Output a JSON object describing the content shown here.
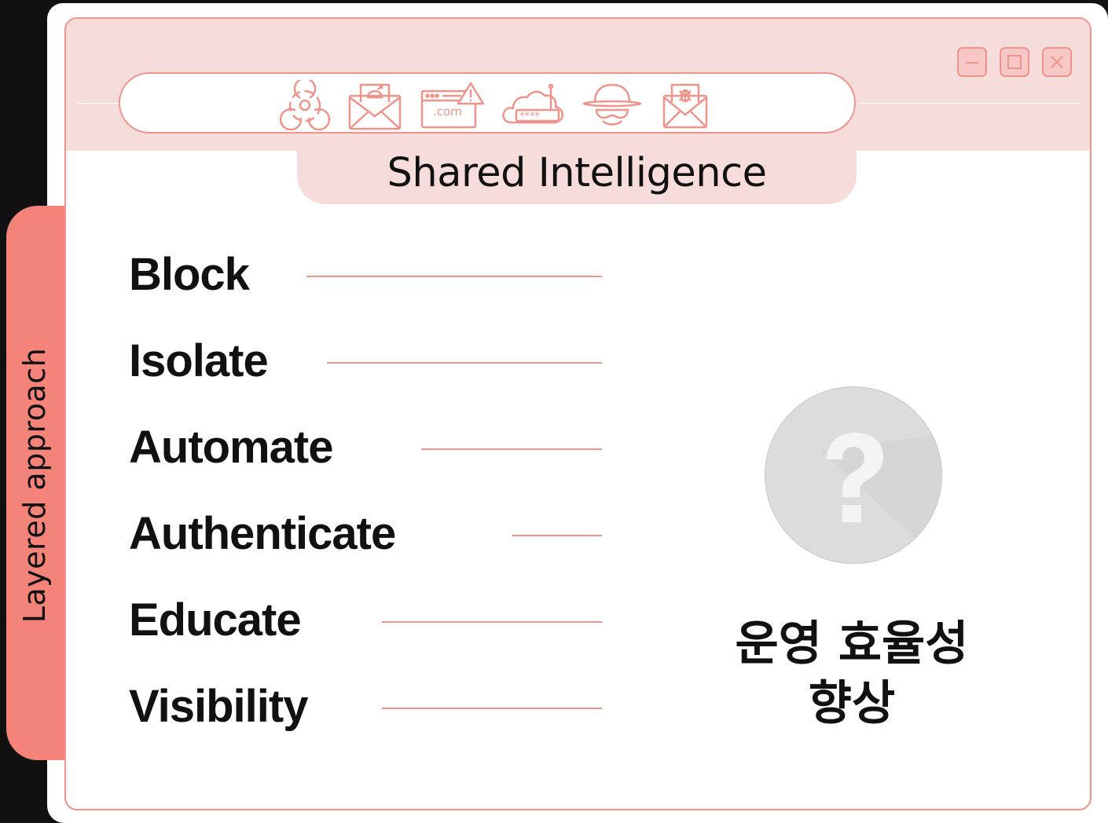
{
  "sidebar": {
    "label": "Layered approach"
  },
  "toolbar": {
    "icons": [
      "biohazard-icon",
      "phishing-mail-icon",
      "malicious-domain-icon",
      "credential-cloud-icon",
      "hacker-icon",
      "malware-mail-icon"
    ]
  },
  "window_controls": [
    "minimize-icon",
    "maximize-icon",
    "close-icon"
  ],
  "heading": {
    "title": "Shared Intelligence"
  },
  "layers": [
    {
      "label": "Block"
    },
    {
      "label": "Isolate"
    },
    {
      "label": "Automate"
    },
    {
      "label": "Authenticate"
    },
    {
      "label": "Educate"
    },
    {
      "label": "Visibility"
    }
  ],
  "result": {
    "icon": "question-mark-icon",
    "line1": "운영 효율성",
    "line2": "향상"
  },
  "colors": {
    "accent": "#f0938b",
    "tab": "#f4837a",
    "titlebar": "#f7dcdc",
    "background": "#111111"
  }
}
